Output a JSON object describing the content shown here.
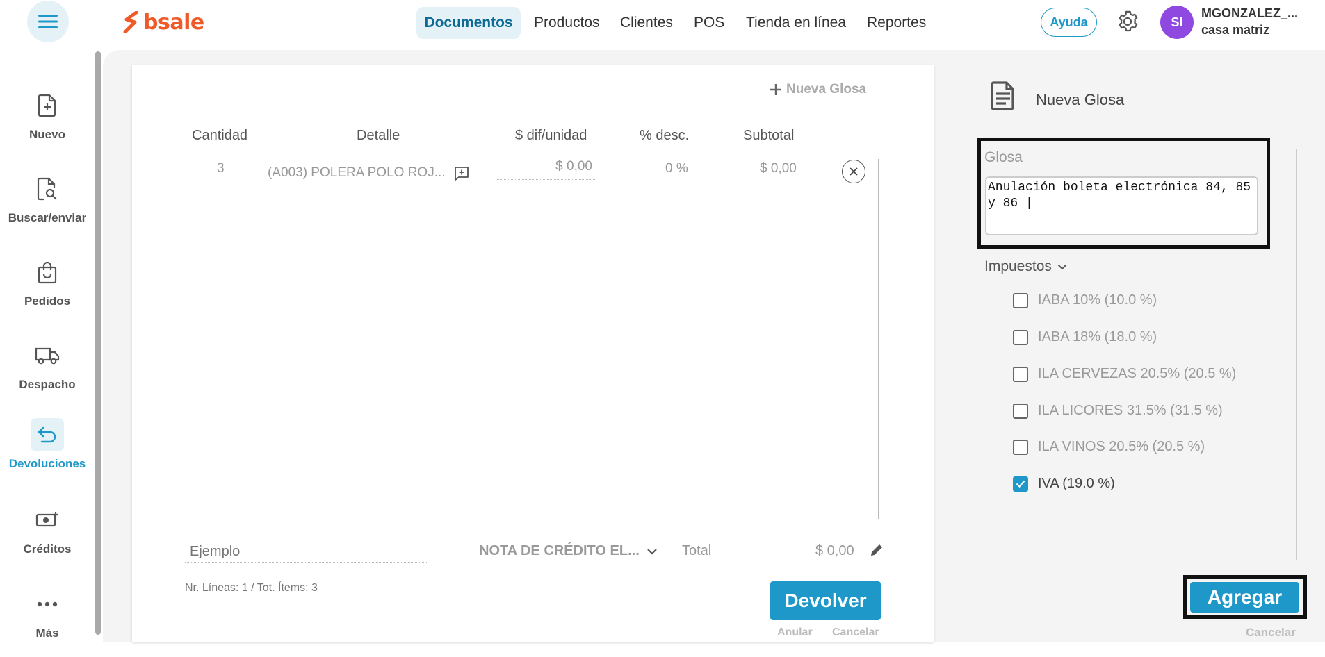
{
  "brand": {
    "logo_text": "bsale",
    "accent": "#1e98c8",
    "logo_color": "#f05a28"
  },
  "topnav": {
    "items": [
      "Documentos",
      "Productos",
      "Clientes",
      "POS",
      "Tienda en línea",
      "Reportes"
    ],
    "active": "Documentos",
    "help_label": "Ayuda",
    "avatar_initials": "SI",
    "user_name": "MGONZALEZ_...",
    "user_branch": "casa matriz"
  },
  "sidebar": {
    "items": [
      {
        "label": "Nuevo",
        "icon": "file-plus-icon"
      },
      {
        "label": "Buscar/enviar",
        "icon": "file-search-icon"
      },
      {
        "label": "Pedidos",
        "icon": "shopping-bag-icon"
      },
      {
        "label": "Despacho",
        "icon": "truck-icon"
      },
      {
        "label": "Devoluciones",
        "icon": "return-arrow-icon"
      },
      {
        "label": "Créditos",
        "icon": "cash-plus-icon"
      },
      {
        "label": "Más",
        "icon": "more-dots-icon"
      }
    ],
    "active": "Devoluciones"
  },
  "document": {
    "new_glosa_label": "Nueva Glosa",
    "columns": [
      "Cantidad",
      "Detalle",
      "$ dif/unidad",
      "% desc.",
      "Subtotal"
    ],
    "rows": [
      {
        "cantidad": "3",
        "detalle": "(A003) POLERA POLO ROJ...",
        "dif_unidad": "$ 0,00",
        "desc": "0 %",
        "subtotal": "$ 0,00"
      }
    ],
    "example_placeholder": "Ejemplo",
    "doc_type": "NOTA DE CRÉDITO EL...",
    "total_label": "Total",
    "total_value": "$ 0,00",
    "lines_info": "Nr. Líneas: 1 / Tot. Ítems: 3",
    "devolver_label": "Devolver",
    "anular_label": "Anular",
    "cancelar_label": "Cancelar"
  },
  "glosa_panel": {
    "title": "Nueva Glosa",
    "glosa_label": "Glosa",
    "glosa_value": "Anulación boleta electrónica 84, 85\ny 86 |",
    "impuestos_label": "Impuestos",
    "taxes": [
      {
        "label": "IABA 10% (10.0 %)",
        "checked": false
      },
      {
        "label": "IABA 18% (18.0 %)",
        "checked": false
      },
      {
        "label": "ILA CERVEZAS 20.5% (20.5 %)",
        "checked": false
      },
      {
        "label": "ILA LICORES 31.5% (31.5 %)",
        "checked": false
      },
      {
        "label": "ILA VINOS 20.5% (20.5 %)",
        "checked": false
      },
      {
        "label": "IVA (19.0 %)",
        "checked": true
      }
    ],
    "agregar_label": "Agregar",
    "cancelar_label": "Cancelar"
  }
}
